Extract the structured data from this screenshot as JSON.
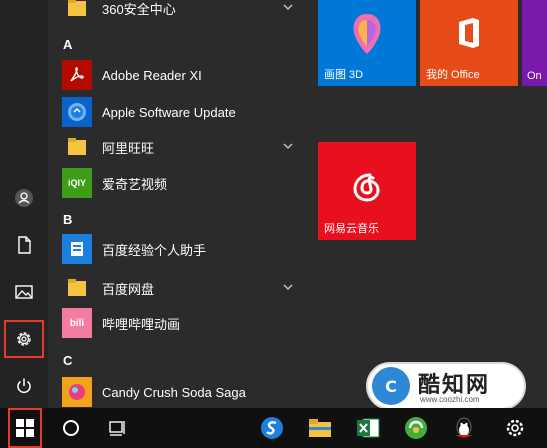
{
  "colors": {
    "tile_blue": "#0078d7",
    "tile_orange": "#e84b1a",
    "tile_red": "#e8101e",
    "highlight_red": "#e8392f"
  },
  "sections": [
    "A",
    "B",
    "C"
  ],
  "apps": [
    {
      "label": "360安全中心",
      "icon": "folder-icon",
      "expandable": true
    },
    {
      "label": "Adobe Reader XI",
      "icon": "adobe-reader-icon",
      "expandable": false
    },
    {
      "label": "Apple Software Update",
      "icon": "apple-update-icon",
      "expandable": false
    },
    {
      "label": "阿里旺旺",
      "icon": "folder-icon",
      "expandable": true
    },
    {
      "label": "爱奇艺视频",
      "icon": "iqiyi-icon",
      "expandable": false
    },
    {
      "label": "百度经验个人助手",
      "icon": "baidu-jingyan-icon",
      "expandable": false
    },
    {
      "label": "百度网盘",
      "icon": "folder-icon",
      "expandable": true
    },
    {
      "label": "哔哩哔哩动画",
      "icon": "bilibili-icon",
      "expandable": false
    },
    {
      "label": "Candy Crush Soda Saga",
      "icon": "candy-crush-icon",
      "expandable": false
    }
  ],
  "tiles": [
    {
      "label": "画图 3D",
      "icon": "paint3d-icon"
    },
    {
      "label": "我的 Office",
      "icon": "office-icon"
    },
    {
      "label": "On",
      "icon": "onenote-icon"
    },
    {
      "label": "网易云音乐",
      "icon": "netease-music-icon"
    }
  ],
  "iqiyi_text": "iQIY",
  "bilibili_text": "bili",
  "watermark": {
    "logo": "C",
    "name": "酷知网",
    "url": "www.coozhi.com"
  }
}
